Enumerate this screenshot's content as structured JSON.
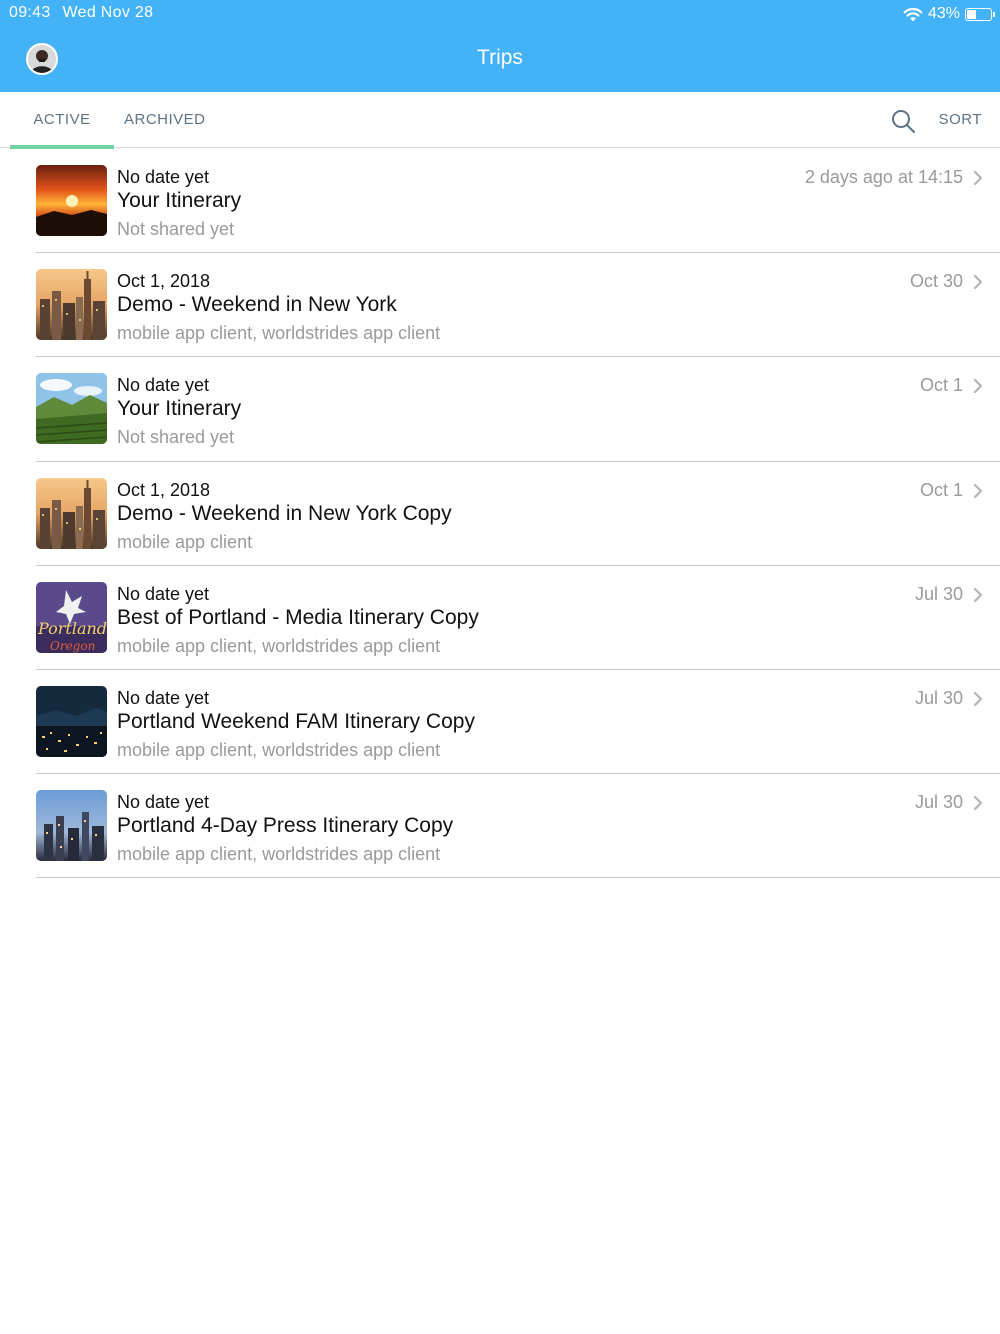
{
  "status_bar": {
    "time": "09:43",
    "date": "Wed Nov 28",
    "battery": "43%",
    "battery_level": 0.43
  },
  "header": {
    "title": "Trips",
    "background": "#44b2f7"
  },
  "tabs": [
    {
      "label": "ACTIVE",
      "active": true
    },
    {
      "label": "ARCHIVED",
      "active": false
    }
  ],
  "toolbar": {
    "sort_label": "SORT",
    "search_icon": "search-icon"
  },
  "accent_color": "#6fd3a3",
  "trips": [
    {
      "date": "No date yet",
      "title": "Your Itinerary",
      "shared": "Not shared yet",
      "updated": "2 days ago at 14:15",
      "thumb": "sunset"
    },
    {
      "date": "Oct 1, 2018",
      "title": "Demo - Weekend in New York",
      "shared": "mobile app client, worldstrides app client",
      "updated": "Oct 30",
      "thumb": "nyc"
    },
    {
      "date": "No date yet",
      "title": "Your Itinerary",
      "shared": "Not shared yet",
      "updated": "Oct 1",
      "thumb": "vineyard"
    },
    {
      "date": "Oct 1, 2018",
      "title": "Demo - Weekend in New York Copy",
      "shared": "mobile app client",
      "updated": "Oct 1",
      "thumb": "nyc"
    },
    {
      "date": "No date yet",
      "title": "Best of Portland - Media Itinerary Copy",
      "shared": "mobile app client, worldstrides app client",
      "updated": "Jul 30",
      "thumb": "portland-sign"
    },
    {
      "date": "No date yet",
      "title": "Portland Weekend FAM Itinerary Copy",
      "shared": "mobile app client, worldstrides app client",
      "updated": "Jul 30",
      "thumb": "night-city"
    },
    {
      "date": "No date yet",
      "title": "Portland 4-Day Press Itinerary Copy",
      "shared": "mobile app client, worldstrides app client",
      "updated": "Jul 30",
      "thumb": "dusk-city"
    }
  ]
}
